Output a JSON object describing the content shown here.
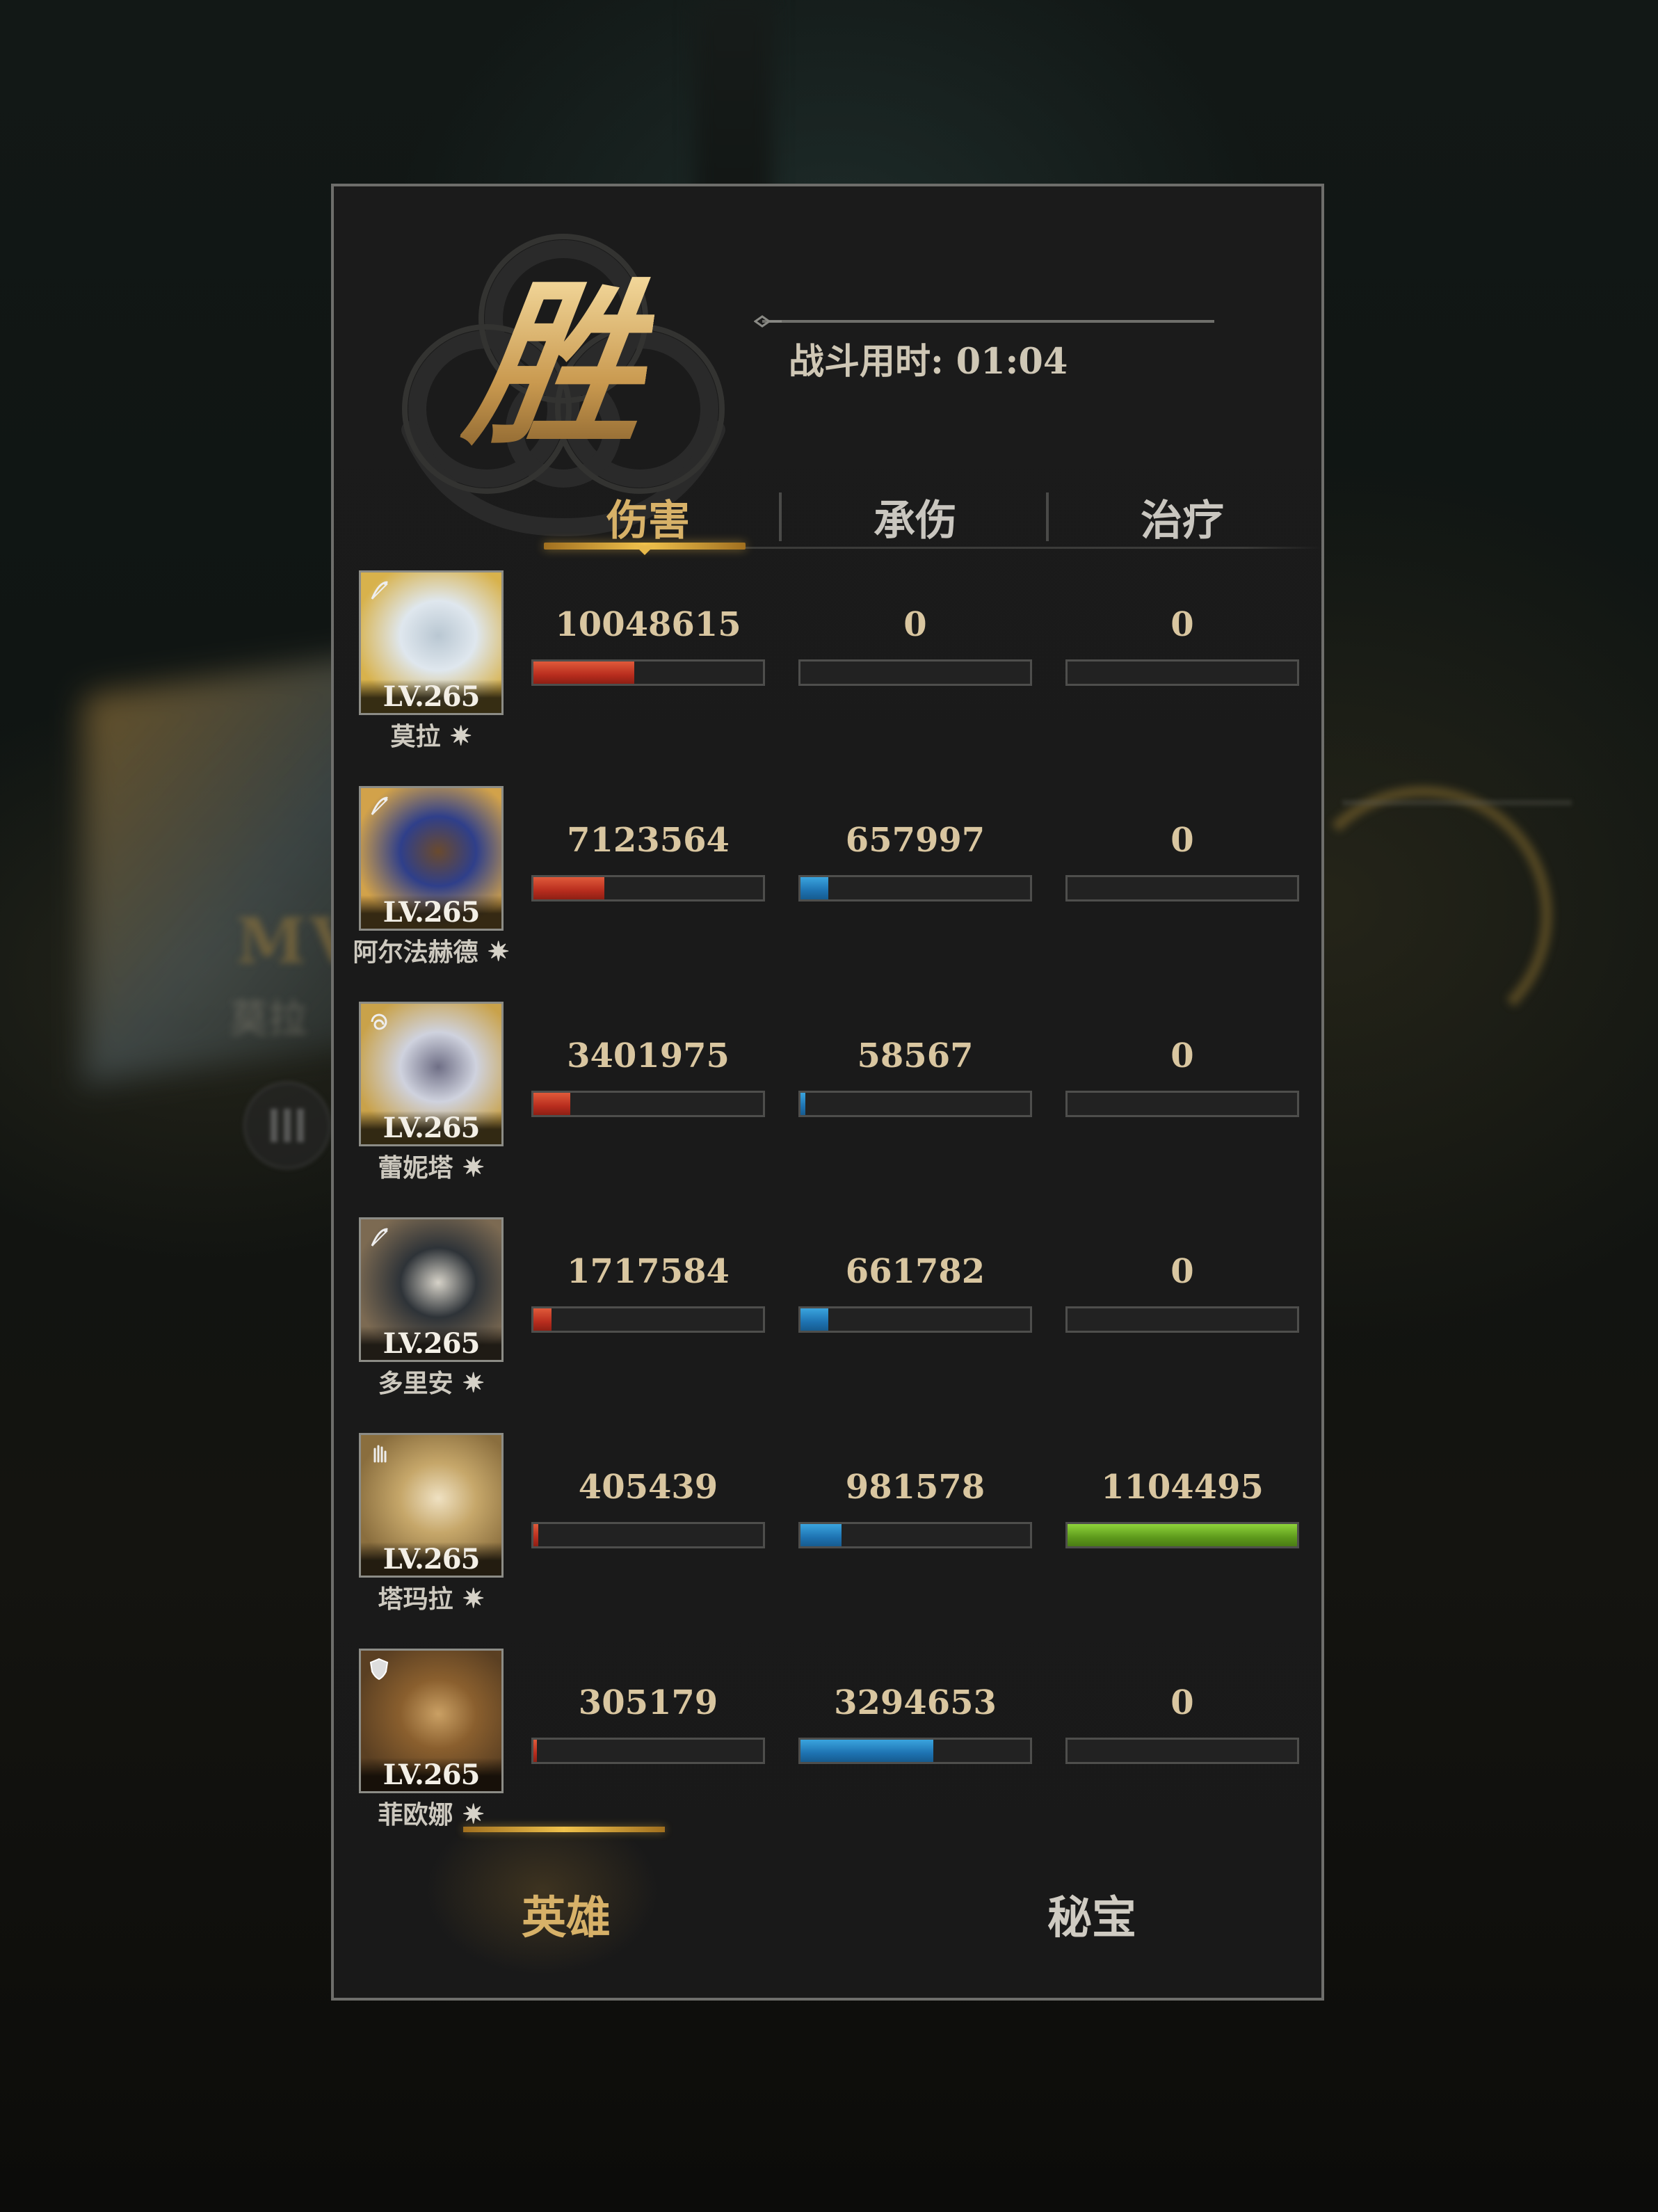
{
  "background": {
    "mvp_text": "MV",
    "mvp_name_partial": "莫拉"
  },
  "result": {
    "victory_label": "胜",
    "battle_time": "战斗用时: 01:04"
  },
  "tabs": [
    {
      "label": "伤害",
      "active": true
    },
    {
      "label": "承伤",
      "active": false
    },
    {
      "label": "治疗",
      "active": false
    }
  ],
  "heroes": [
    {
      "name": "莫拉",
      "level": "LV.265",
      "class_icon": "bow-icon",
      "damage": "10048615",
      "taken": "0",
      "heal": "0",
      "damage_frac": 0.44,
      "taken_frac": 0.0,
      "heal_frac": 0.0,
      "palette": [
        "#dfe7ee",
        "#b9c7d2",
        "#d8b24c"
      ]
    },
    {
      "name": "阿尔法赫德",
      "level": "LV.265",
      "class_icon": "bow-icon",
      "damage": "7123564",
      "taken": "657997",
      "heal": "0",
      "damage_frac": 0.31,
      "taken_frac": 0.12,
      "heal_frac": 0.0,
      "palette": [
        "#2f3f8a",
        "#6a4a2e",
        "#d2a24a"
      ]
    },
    {
      "name": "蕾妮塔",
      "level": "LV.265",
      "class_icon": "swirl-icon",
      "damage": "3401975",
      "taken": "58567",
      "heal": "0",
      "damage_frac": 0.16,
      "taken_frac": 0.02,
      "heal_frac": 0.0,
      "palette": [
        "#cfd2de",
        "#6f6f86",
        "#c9a24a"
      ]
    },
    {
      "name": "多里安",
      "level": "LV.265",
      "class_icon": "bow-icon",
      "damage": "1717584",
      "taken": "661782",
      "heal": "0",
      "damage_frac": 0.08,
      "taken_frac": 0.12,
      "heal_frac": 0.0,
      "palette": [
        "#2e3338",
        "#d6d2c8",
        "#7c6a52"
      ]
    },
    {
      "name": "塔玛拉",
      "level": "LV.265",
      "class_icon": "hand-icon",
      "damage": "405439",
      "taken": "981578",
      "heal": "1104495",
      "damage_frac": 0.02,
      "taken_frac": 0.18,
      "heal_frac": 1.0,
      "palette": [
        "#c6a76a",
        "#efe1c2",
        "#8a6e3e"
      ]
    },
    {
      "name": "菲欧娜",
      "level": "LV.265",
      "class_icon": "shield-icon",
      "damage": "305179",
      "taken": "3294653",
      "heal": "0",
      "damage_frac": 0.015,
      "taken_frac": 0.58,
      "heal_frac": 0.0,
      "palette": [
        "#8a5f2e",
        "#caa064",
        "#5a3f22"
      ]
    }
  ],
  "bottom_tabs": [
    {
      "label": "英雄",
      "active": true
    },
    {
      "label": "秘宝",
      "active": false
    }
  ],
  "colors": {
    "accent_gold": "#d7b168",
    "damage_bar": "#c8351f",
    "taken_bar": "#2286c8",
    "heal_bar": "#6fb426"
  }
}
